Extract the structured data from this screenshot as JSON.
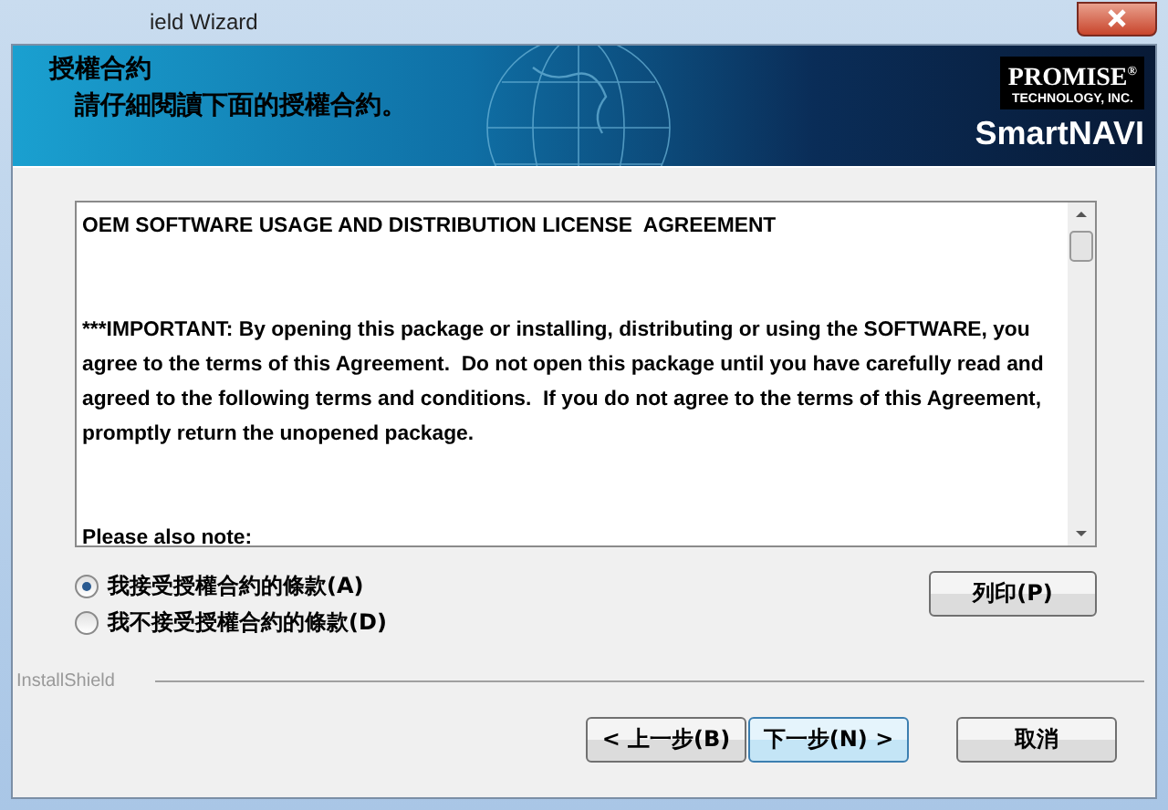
{
  "window": {
    "title": "ield Wizard"
  },
  "header": {
    "title": "授權合約",
    "subtitle": "請仔細閱讀下面的授權合約。",
    "logo": {
      "brand": "PROMISE$^{®}$",
      "tagline": "TECHNOLOGY, INC.",
      "product": "SmartNAVI"
    }
  },
  "license": {
    "paragraphs": [
      "OEM SOFTWARE USAGE AND DISTRIBUTION LICENSE  AGREEMENT",
      "***IMPORTANT: By opening this package or installing, distributing or using the SOFTWARE, you agree to the terms of this Agreement.  Do not open this package until you have carefully read and agreed to the following terms and conditions.  If you do not agree to the terms of this Agreement, promptly return the unopened package.",
      "Please also note:"
    ]
  },
  "options": [
    {
      "label": "我接受授權合約的條款(A)",
      "selected": true
    },
    {
      "label": "我不接受授權合約的條款(D)",
      "selected": false
    }
  ],
  "print_button": "列印(P)",
  "footer": {
    "brand": "InstallShield"
  },
  "buttons": [
    {
      "label": "< 上一步(B)",
      "default": false
    },
    {
      "label": "下一步(N) >",
      "default": true
    },
    {
      "label": "取消",
      "default": false
    }
  ]
}
